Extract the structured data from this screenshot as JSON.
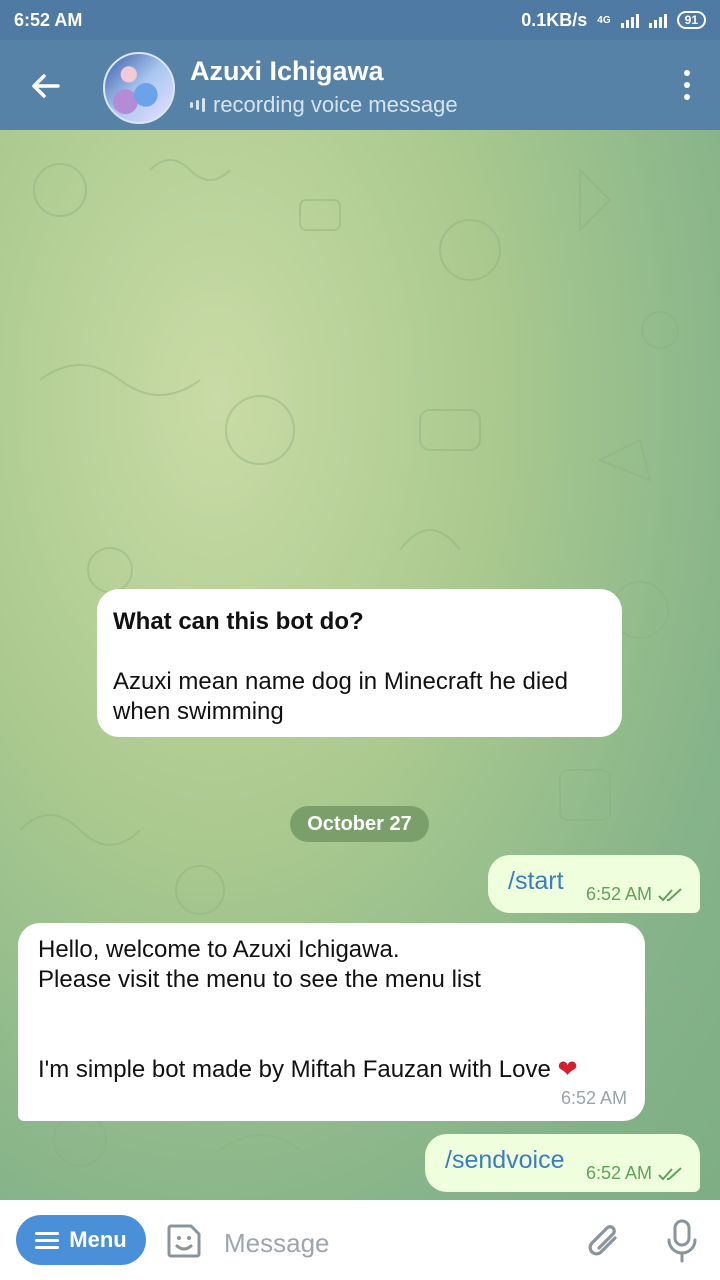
{
  "status_bar": {
    "time": "6:52 AM",
    "net_speed": "0.1KB/s",
    "network_type": "4G",
    "battery": "91"
  },
  "header": {
    "chat_name": "Azuxi Ichigawa",
    "chat_status": "recording voice message"
  },
  "bot_info": {
    "question": "What can this bot do?",
    "description": "Azuxi mean name dog in Minecraft he died when swimming"
  },
  "date_separator": "October 27",
  "messages": [
    {
      "direction": "out",
      "text": "/start",
      "time": "6:52 AM",
      "status": "read"
    },
    {
      "direction": "in",
      "lines": [
        "Hello, welcome to Azuxi Ichigawa.",
        "Please visit the menu to see the menu list",
        "I'm simple bot made by Miftah Fauzan with Love"
      ],
      "emoji": "❤",
      "time": "6:52 AM"
    },
    {
      "direction": "out",
      "text": "/sendvoice",
      "time": "6:52 AM",
      "status": "read"
    }
  ],
  "input_bar": {
    "menu_label": "Menu",
    "placeholder": "Message"
  },
  "colors": {
    "header": "#5682a8",
    "status_bar": "#4f7aa3",
    "outgoing_bubble": "#effedd",
    "menu_button": "#4a90d9"
  },
  "icons": [
    "back-arrow-icon",
    "more-vert-icon",
    "recording-icon",
    "double-check-icon",
    "hamburger-icon",
    "sticker-icon",
    "paperclip-icon",
    "microphone-icon"
  ]
}
